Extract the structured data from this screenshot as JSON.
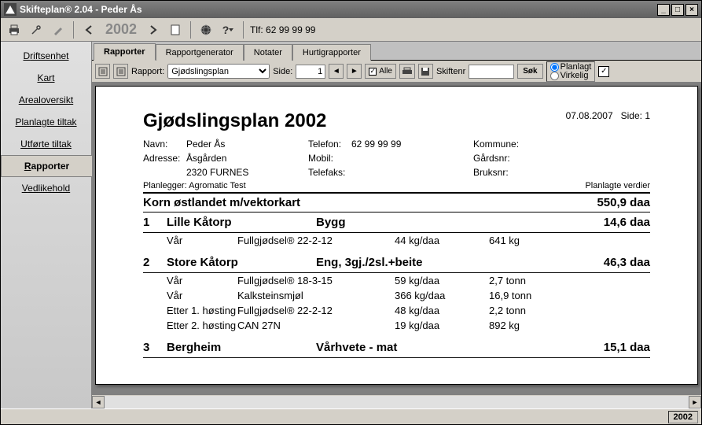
{
  "window": {
    "title": "Skifteplan® 2.04 - Peder Ås"
  },
  "toolbar": {
    "year": "2002",
    "tlf": "Tlf: 62 99 99 99"
  },
  "sidebar": {
    "items": [
      {
        "label": "Driftsenhet"
      },
      {
        "label": "Kart"
      },
      {
        "label": "Arealoversikt"
      },
      {
        "label": "Planlagte tiltak"
      },
      {
        "label": "Utførte tiltak"
      },
      {
        "label": "Rapporter"
      },
      {
        "label": "Vedlikehold"
      }
    ],
    "active": 5
  },
  "tabs": {
    "items": [
      {
        "label": "Rapporter"
      },
      {
        "label": "Rapportgenerator"
      },
      {
        "label": "Notater"
      },
      {
        "label": "Hurtigrapporter"
      }
    ],
    "active": 0
  },
  "innerbar": {
    "rapport_label": "Rapport:",
    "rapport_value": "Gjødslingsplan",
    "side_label": "Side:",
    "side_value": "1",
    "alle": "Alle",
    "skiftenr": "Skiftenr",
    "skiftenr_value": "",
    "sok": "Søk",
    "planlagt": "Planlagt",
    "virkelig": "Virkelig"
  },
  "report": {
    "date": "07.08.2007",
    "side": "Side: 1",
    "title": "Gjødslingsplan 2002",
    "navn_l": "Navn:",
    "navn": "Peder Ås",
    "adr_l": "Adresse:",
    "adr1": "Åsgården",
    "adr2": "2320  FURNES",
    "tel_l": "Telefon:",
    "tel": "62 99 99 99",
    "mob_l": "Mobil:",
    "mob": "",
    "fax_l": "Telefaks:",
    "fax": "",
    "kom_l": "Kommune:",
    "gard_l": "Gårdsnr:",
    "bruk_l": "Bruksnr:",
    "planlegger_l": "Planlegger:",
    "planlegger": "Agromatic Test",
    "planverd": "Planlagte verdier",
    "sec_title": "Korn østlandet m/vektorkart",
    "sec_area": "550,9 daa",
    "fields": [
      {
        "num": "1",
        "name": "Lille Kåtorp",
        "crop": "Bygg",
        "area": "14,6 daa",
        "entries": [
          {
            "time": "Vår",
            "prod": "Fullgjødsel® 22-2-12",
            "rate": "44 kg/daa",
            "tot": "641 kg"
          }
        ]
      },
      {
        "num": "2",
        "name": "Store Kåtorp",
        "crop": "Eng, 3gj./2sl.+beite",
        "area": "46,3 daa",
        "entries": [
          {
            "time": "Vår",
            "prod": "Fullgjødsel® 18-3-15",
            "rate": "59 kg/daa",
            "tot": "2,7 tonn"
          },
          {
            "time": "Vår",
            "prod": "Kalksteinsmjøl",
            "rate": "366 kg/daa",
            "tot": "16,9 tonn"
          },
          {
            "time": "Etter 1. høsting",
            "prod": "Fullgjødsel® 22-2-12",
            "rate": "48 kg/daa",
            "tot": "2,2 tonn"
          },
          {
            "time": "Etter 2. høsting",
            "prod": "CAN 27N",
            "rate": "19 kg/daa",
            "tot": "892 kg"
          }
        ]
      },
      {
        "num": "3",
        "name": "Bergheim",
        "crop": "Vårhvete - mat",
        "area": "15,1 daa",
        "entries": []
      }
    ]
  },
  "status": {
    "corner": "2002"
  }
}
